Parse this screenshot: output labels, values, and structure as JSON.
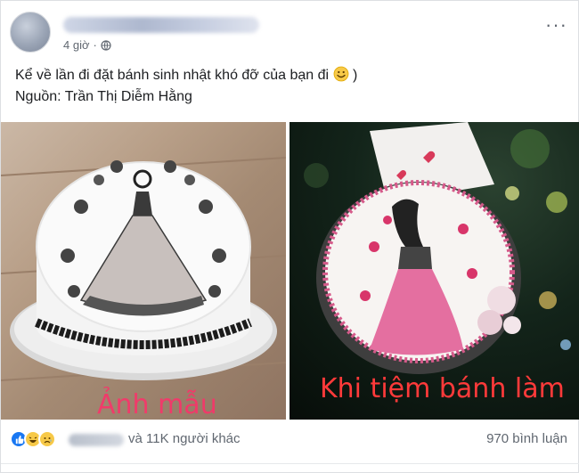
{
  "post": {
    "time": "4 giờ",
    "text_line1": "Kể về lần đi đặt bánh sinh nhật khó đỡ của bạn đi",
    "text_line1_suffix": ")",
    "text_line2": "Nguồn: Trần Thị Diễm Hằng",
    "more_icon": "more-icon",
    "privacy_icon": "globe-icon"
  },
  "photos": {
    "left_caption": "Ảnh mẫu",
    "right_caption": "Khi tiệm bánh làm"
  },
  "footer": {
    "reaction_icons": [
      "like-icon",
      "haha-icon",
      "sad-icon"
    ],
    "reactions_text": "và 11K người khác",
    "comments_text": "970 bình luận"
  },
  "colors": {
    "text": "#1c1e21",
    "secondary_text": "#606770",
    "like_blue": "#1877f2",
    "emoji_yellow": "#f7c948",
    "caption_pink": "#ff2f6a",
    "caption_red": "#ff3a3a"
  }
}
